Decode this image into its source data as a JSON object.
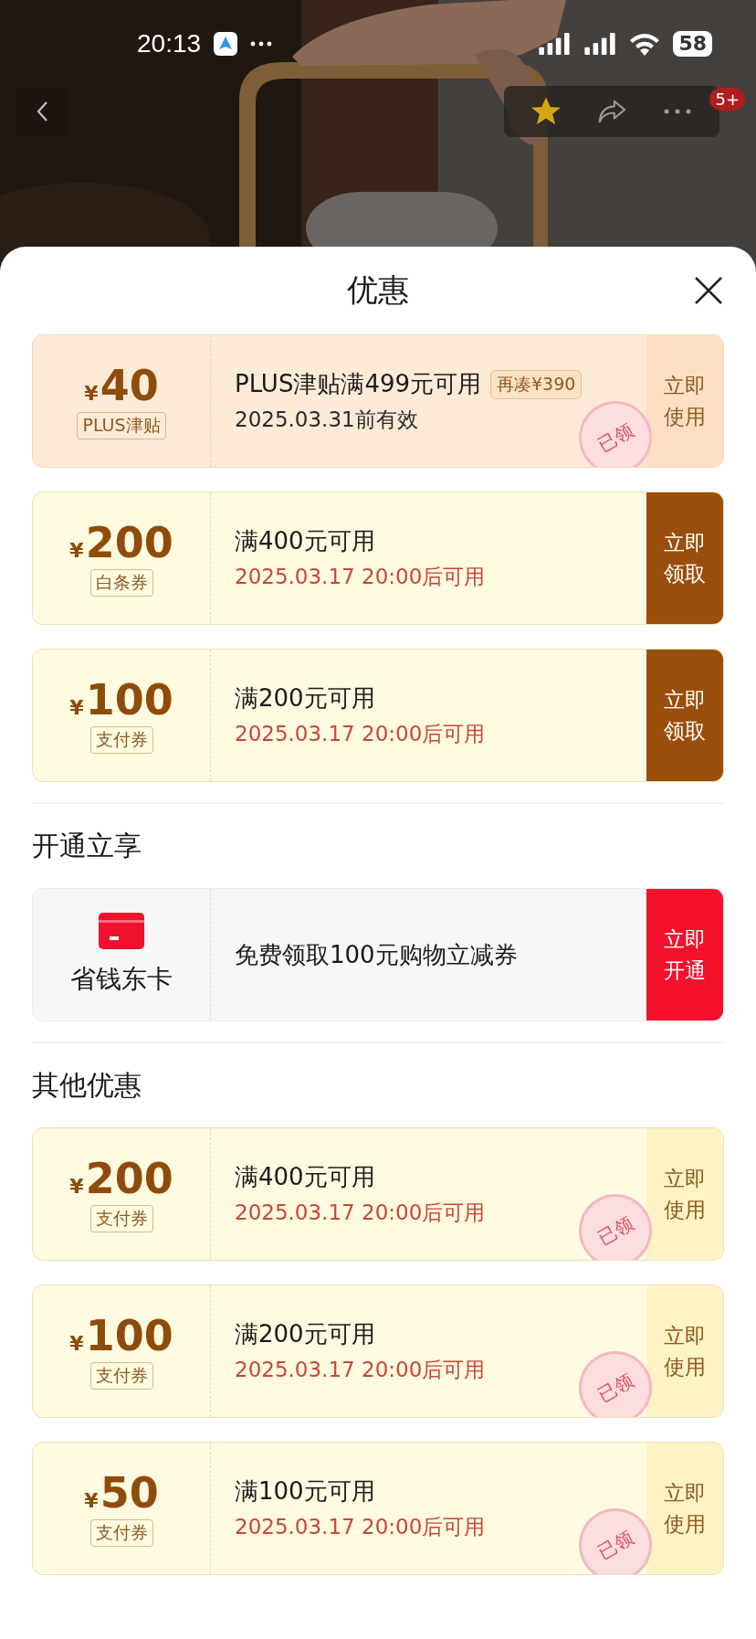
{
  "status_bar": {
    "time": "20:13",
    "battery": "58"
  },
  "nav": {
    "badge": "5+",
    "favorited": true
  },
  "sheet": {
    "title": "优惠",
    "sections": [
      {
        "items": [
          {
            "kind": "coupon",
            "plus": true,
            "currency": "¥",
            "amount": "40",
            "tag": "PLUS津贴",
            "condition": "PLUS津贴满499元可用",
            "extra": "再凑¥390",
            "validity": "2025.03.31前有效",
            "pending": false,
            "action": "立即使用",
            "claimed": true,
            "stamp": "已领"
          },
          {
            "kind": "coupon",
            "plus": false,
            "currency": "¥",
            "amount": "200",
            "tag": "白条券",
            "condition": "满400元可用",
            "validity": "2025.03.17 20:00后可用",
            "pending": true,
            "action": "立即领取",
            "claimed": false
          },
          {
            "kind": "coupon",
            "plus": false,
            "currency": "¥",
            "amount": "100",
            "tag": "支付券",
            "condition": "满200元可用",
            "validity": "2025.03.17 20:00后可用",
            "pending": true,
            "action": "立即领取",
            "claimed": false
          }
        ]
      },
      {
        "heading": "开通立享",
        "items": [
          {
            "kind": "card",
            "label": "省钱东卡",
            "condition": "免费领取100元购物立减券",
            "action": "立即开通"
          }
        ]
      },
      {
        "heading": "其他优惠",
        "items": [
          {
            "kind": "coupon",
            "plus": false,
            "currency": "¥",
            "amount": "200",
            "tag": "支付券",
            "condition": "满400元可用",
            "validity": "2025.03.17 20:00后可用",
            "pending": true,
            "action": "立即使用",
            "claimed": true,
            "stamp": "已领"
          },
          {
            "kind": "coupon",
            "plus": false,
            "currency": "¥",
            "amount": "100",
            "tag": "支付券",
            "condition": "满200元可用",
            "validity": "2025.03.17 20:00后可用",
            "pending": true,
            "action": "立即使用",
            "claimed": true,
            "stamp": "已领"
          },
          {
            "kind": "coupon",
            "plus": false,
            "currency": "¥",
            "amount": "50",
            "tag": "支付券",
            "condition": "满100元可用",
            "validity": "2025.03.17 20:00后可用",
            "pending": true,
            "action": "立即使用",
            "claimed": true,
            "stamp": "已领"
          }
        ]
      }
    ]
  }
}
